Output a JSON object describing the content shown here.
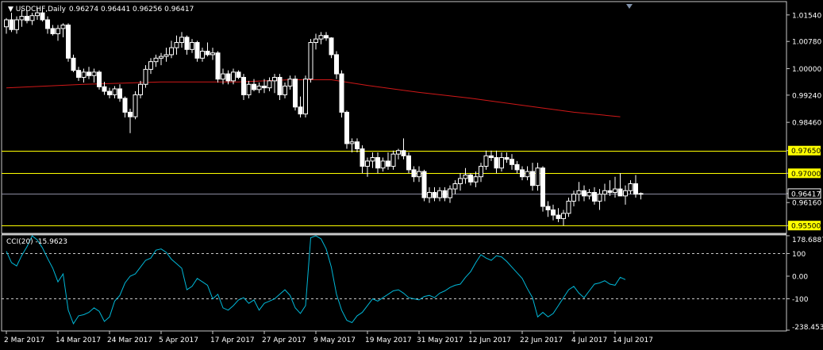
{
  "chart_data": [
    {
      "type": "candlestick",
      "symbol": "USDCHF,Daily",
      "ohlc_header": "0.96274 0.96441 0.96256 0.96417",
      "ylim": [
        0.953,
        1.019
      ],
      "y_ticks": [
        "1.01540",
        "1.00780",
        "1.00000",
        "0.99240",
        "0.98460",
        "0.97650",
        "0.97000",
        "0.96417",
        "0.96160",
        "0.95500"
      ],
      "price_lines": [
        {
          "value": 0.9765,
          "label": "0.97650",
          "color": "#ffff00"
        },
        {
          "value": 0.97,
          "label": "0.97000",
          "color": "#ffff00"
        },
        {
          "value": 0.955,
          "label": "0.95500",
          "color": "#ffff00"
        }
      ],
      "current_price": {
        "value": 0.96417,
        "label": "0.96417",
        "color": "#8c8ca0"
      },
      "candles": [
        [
          1.012,
          1.0145,
          1.01,
          1.014
        ],
        [
          1.014,
          1.016,
          1.0105,
          1.0112
        ],
        [
          1.0112,
          1.015,
          1.01,
          1.014
        ],
        [
          1.014,
          1.017,
          1.012,
          1.015
        ],
        [
          1.015,
          1.0165,
          1.013,
          1.0138
        ],
        [
          1.0138,
          1.016,
          1.0125,
          1.0152
        ],
        [
          1.0152,
          1.0175,
          1.014,
          1.016
        ],
        [
          1.016,
          1.017,
          1.0135,
          1.014
        ],
        [
          1.014,
          1.015,
          1.01,
          1.0115
        ],
        [
          1.0115,
          1.0125,
          1.0095,
          1.01
        ],
        [
          1.01,
          1.0125,
          1.008,
          1.0115
        ],
        [
          1.0115,
          1.013,
          1.009,
          1.0125
        ],
        [
          1.0125,
          1.013,
          1.002,
          1.003
        ],
        [
          1.003,
          1.004,
          0.999,
          0.9995
        ],
        [
          0.9995,
          1.0005,
          0.9965,
          0.9975
        ],
        [
          0.9975,
          1.0,
          0.996,
          0.999
        ],
        [
          0.999,
          1.0005,
          0.997,
          0.998
        ],
        [
          0.998,
          1.0,
          0.996,
          0.999
        ],
        [
          0.999,
          0.9995,
          0.994,
          0.9948
        ],
        [
          0.9948,
          0.9962,
          0.9925,
          0.9935
        ],
        [
          0.9935,
          0.9945,
          0.9915,
          0.9925
        ],
        [
          0.9925,
          0.995,
          0.9915,
          0.9942
        ],
        [
          0.9942,
          0.9955,
          0.9905,
          0.9915
        ],
        [
          0.9915,
          0.992,
          0.986,
          0.9875
        ],
        [
          0.9875,
          0.9885,
          0.9815,
          0.9862
        ],
        [
          0.9862,
          0.9935,
          0.9855,
          0.9925
        ],
        [
          0.9925,
          0.9965,
          0.9915,
          0.9955
        ],
        [
          0.9955,
          1.001,
          0.9945,
          0.9998
        ],
        [
          0.9998,
          1.003,
          0.9985,
          1.002
        ],
        [
          1.002,
          1.004,
          1.0005,
          1.003
        ],
        [
          1.003,
          1.0045,
          1.001,
          1.0035
        ],
        [
          1.0035,
          1.006,
          1.002,
          1.004
        ],
        [
          1.004,
          1.008,
          1.003,
          1.006
        ],
        [
          1.006,
          1.0095,
          1.004,
          1.0075
        ],
        [
          1.0075,
          1.0105,
          1.006,
          1.009
        ],
        [
          1.009,
          1.0095,
          1.004,
          1.0055
        ],
        [
          1.0055,
          1.0085,
          1.0045,
          1.0075
        ],
        [
          1.0075,
          1.008,
          1.002,
          1.003
        ],
        [
          1.003,
          1.006,
          1.002,
          1.005
        ],
        [
          1.005,
          1.0075,
          1.0035,
          1.004
        ],
        [
          1.004,
          1.006,
          1.0025,
          1.0045
        ],
        [
          1.0045,
          1.005,
          0.996,
          0.997
        ],
        [
          0.997,
          1.0,
          0.9955,
          0.9985
        ],
        [
          0.9985,
          0.9995,
          0.9955,
          0.9965
        ],
        [
          0.9965,
          1.0,
          0.9955,
          0.999
        ],
        [
          0.999,
          0.9995,
          0.997,
          0.9975
        ],
        [
          0.9975,
          0.9985,
          0.991,
          0.9925
        ],
        [
          0.9925,
          0.9965,
          0.9915,
          0.9955
        ],
        [
          0.9955,
          0.997,
          0.9935,
          0.994
        ],
        [
          0.994,
          0.996,
          0.993,
          0.995
        ],
        [
          0.995,
          0.997,
          0.993,
          0.9945
        ],
        [
          0.9945,
          0.9975,
          0.9935,
          0.9965
        ],
        [
          0.9965,
          0.9985,
          0.993,
          0.9975
        ],
        [
          0.9975,
          0.9985,
          0.991,
          0.9925
        ],
        [
          0.9925,
          0.996,
          0.9915,
          0.995
        ],
        [
          0.995,
          0.998,
          0.994,
          0.997
        ],
        [
          0.997,
          0.998,
          0.988,
          0.989
        ],
        [
          0.989,
          0.992,
          0.986,
          0.987
        ],
        [
          0.987,
          0.998,
          0.986,
          0.997
        ],
        [
          0.997,
          1.0085,
          0.996,
          1.0075
        ],
        [
          1.0075,
          1.01,
          1.0055,
          1.0085
        ],
        [
          1.0085,
          1.0105,
          1.007,
          1.0095
        ],
        [
          1.0095,
          1.0105,
          1.008,
          1.0088
        ],
        [
          1.0088,
          1.009,
          1.003,
          1.004
        ],
        [
          1.004,
          1.005,
          0.997,
          0.9985
        ],
        [
          0.9985,
          0.9995,
          0.986,
          0.9875
        ],
        [
          0.9875,
          0.988,
          0.977,
          0.9785
        ],
        [
          0.9785,
          0.98,
          0.976,
          0.979
        ],
        [
          0.979,
          0.98,
          0.976,
          0.977
        ],
        [
          0.977,
          0.978,
          0.97,
          0.972
        ],
        [
          0.972,
          0.9745,
          0.969,
          0.9735
        ],
        [
          0.9735,
          0.976,
          0.9715,
          0.9745
        ],
        [
          0.9745,
          0.976,
          0.97,
          0.9715
        ],
        [
          0.9715,
          0.9745,
          0.9705,
          0.9735
        ],
        [
          0.9735,
          0.976,
          0.971,
          0.972
        ],
        [
          0.972,
          0.9765,
          0.971,
          0.9755
        ],
        [
          0.9755,
          0.977,
          0.974,
          0.9765
        ],
        [
          0.9765,
          0.98,
          0.974,
          0.975
        ],
        [
          0.975,
          0.976,
          0.97,
          0.971
        ],
        [
          0.971,
          0.972,
          0.9675,
          0.969
        ],
        [
          0.969,
          0.972,
          0.9675,
          0.9705
        ],
        [
          0.9705,
          0.971,
          0.962,
          0.963
        ],
        [
          0.963,
          0.966,
          0.9615,
          0.9645
        ],
        [
          0.9645,
          0.966,
          0.962,
          0.963
        ],
        [
          0.963,
          0.966,
          0.962,
          0.965
        ],
        [
          0.965,
          0.966,
          0.962,
          0.963
        ],
        [
          0.963,
          0.9665,
          0.9615,
          0.9655
        ],
        [
          0.9655,
          0.968,
          0.964,
          0.967
        ],
        [
          0.967,
          0.97,
          0.965,
          0.9685
        ],
        [
          0.9685,
          0.9715,
          0.967,
          0.9695
        ],
        [
          0.9695,
          0.97,
          0.9665,
          0.9675
        ],
        [
          0.9675,
          0.9705,
          0.966,
          0.969
        ],
        [
          0.969,
          0.973,
          0.9675,
          0.972
        ],
        [
          0.972,
          0.9765,
          0.971,
          0.975
        ],
        [
          0.975,
          0.9765,
          0.9735,
          0.9745
        ],
        [
          0.9745,
          0.9765,
          0.97,
          0.9715
        ],
        [
          0.9715,
          0.976,
          0.9705,
          0.9745
        ],
        [
          0.9745,
          0.976,
          0.973,
          0.974
        ],
        [
          0.974,
          0.9755,
          0.971,
          0.9725
        ],
        [
          0.9725,
          0.9735,
          0.97,
          0.971
        ],
        [
          0.971,
          0.972,
          0.968,
          0.969
        ],
        [
          0.969,
          0.972,
          0.968,
          0.9705
        ],
        [
          0.9705,
          0.973,
          0.965,
          0.9665
        ],
        [
          0.9665,
          0.973,
          0.965,
          0.9715
        ],
        [
          0.9715,
          0.972,
          0.959,
          0.9605
        ],
        [
          0.9605,
          0.962,
          0.9575,
          0.9595
        ],
        [
          0.9595,
          0.961,
          0.9565,
          0.958
        ],
        [
          0.958,
          0.96,
          0.956,
          0.957
        ],
        [
          0.957,
          0.9595,
          0.955,
          0.9585
        ],
        [
          0.9585,
          0.963,
          0.9575,
          0.962
        ],
        [
          0.962,
          0.965,
          0.9605,
          0.964
        ],
        [
          0.964,
          0.9675,
          0.962,
          0.965
        ],
        [
          0.965,
          0.9665,
          0.962,
          0.9635
        ],
        [
          0.9635,
          0.9655,
          0.9625,
          0.9645
        ],
        [
          0.9645,
          0.966,
          0.961,
          0.962
        ],
        [
          0.962,
          0.9655,
          0.9595,
          0.964
        ],
        [
          0.964,
          0.967,
          0.962,
          0.965
        ],
        [
          0.965,
          0.968,
          0.9635,
          0.9645
        ],
        [
          0.9645,
          0.969,
          0.963,
          0.9655
        ],
        [
          0.9655,
          0.97,
          0.964,
          0.9635
        ],
        [
          0.9635,
          0.9665,
          0.961,
          0.965
        ],
        [
          0.965,
          0.968,
          0.964,
          0.967
        ],
        [
          0.967,
          0.9695,
          0.963,
          0.964
        ],
        [
          0.964,
          0.9645,
          0.9625,
          0.9642
        ]
      ],
      "moving_average": {
        "color": "#d01818",
        "points": [
          [
            0,
            0.9945
          ],
          [
            15,
            0.9955
          ],
          [
            30,
            0.9962
          ],
          [
            45,
            0.9962
          ],
          [
            55,
            0.9968
          ],
          [
            63,
            0.9968
          ],
          [
            70,
            0.9952
          ],
          [
            80,
            0.9932
          ],
          [
            90,
            0.9915
          ],
          [
            100,
            0.9895
          ],
          [
            110,
            0.9875
          ],
          [
            119,
            0.9862
          ]
        ]
      },
      "x_ticks": [
        {
          "index": 0,
          "label": "2 Mar 2017"
        },
        {
          "index": 10,
          "label": "14 Mar 2017"
        },
        {
          "index": 20,
          "label": "24 Mar 2017"
        },
        {
          "index": 30,
          "label": "5 Apr 2017"
        },
        {
          "index": 40,
          "label": "17 Apr 2017"
        },
        {
          "index": 50,
          "label": "27 Apr 2017"
        },
        {
          "index": 60,
          "label": "9 May 2017"
        },
        {
          "index": 70,
          "label": "19 May 2017"
        },
        {
          "index": 80,
          "label": "31 May 2017"
        },
        {
          "index": 90,
          "label": "12 Jun 2017"
        },
        {
          "index": 100,
          "label": "22 Jun 2017"
        },
        {
          "index": 110,
          "label": "4 Jul 2017"
        },
        {
          "index": 118,
          "label": "14 Jul 2017"
        }
      ]
    },
    {
      "type": "line",
      "indicator": "CCI(20) -15.9623",
      "ylim": [
        -238.4539,
        178.6887
      ],
      "y_ticks": [
        "178.6887",
        "100",
        "0.00",
        "-100",
        "-238.4539"
      ],
      "levels": [
        100,
        -100
      ],
      "color": "#00b8d8",
      "values": [
        110,
        60,
        45,
        92,
        130,
        178,
        160,
        125,
        78,
        35,
        -25,
        10,
        -150,
        -210,
        -175,
        -170,
        -160,
        -140,
        -155,
        -200,
        -180,
        -110,
        -85,
        -30,
        0,
        10,
        40,
        70,
        80,
        115,
        120,
        105,
        75,
        55,
        35,
        -60,
        -45,
        -10,
        -25,
        -40,
        -100,
        -80,
        -140,
        -150,
        -130,
        -105,
        -95,
        -120,
        -105,
        -150,
        -120,
        -110,
        -100,
        -80,
        -60,
        -85,
        -140,
        -165,
        -130,
        170,
        178,
        165,
        120,
        40,
        -80,
        -150,
        -195,
        -205,
        -175,
        -160,
        -130,
        -100,
        -110,
        -95,
        -80,
        -65,
        -60,
        -75,
        -95,
        -100,
        -105,
        -90,
        -85,
        -95,
        -75,
        -65,
        -50,
        -40,
        -35,
        -5,
        20,
        60,
        95,
        80,
        70,
        90,
        85,
        65,
        40,
        15,
        -10,
        -55,
        -95,
        -180,
        -160,
        -180,
        -165,
        -130,
        -95,
        -60,
        -45,
        -75,
        -95,
        -65,
        -35,
        -30,
        -20,
        -35,
        -40,
        -5,
        -15
      ]
    }
  ]
}
